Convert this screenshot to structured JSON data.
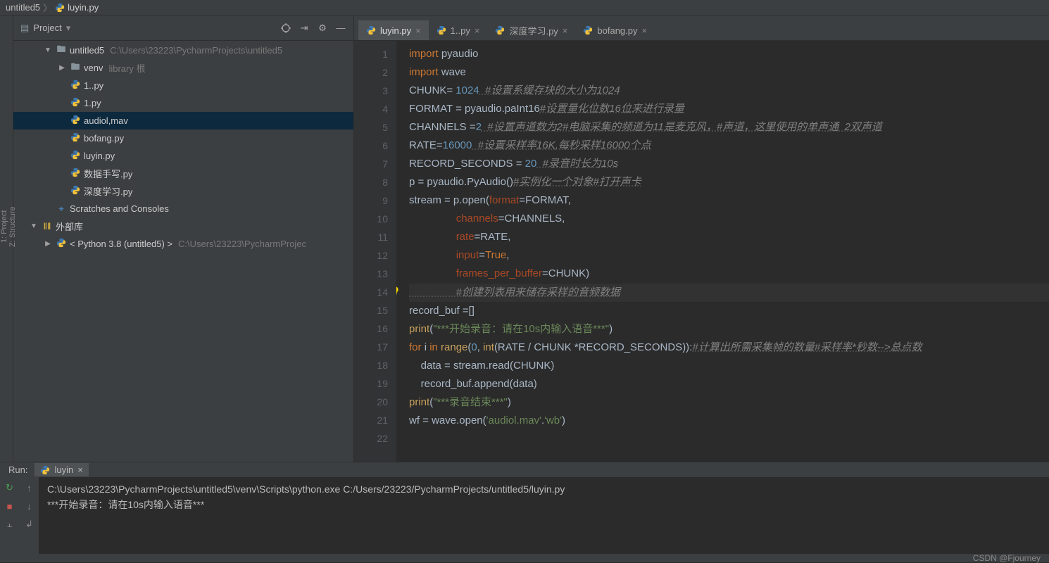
{
  "breadcrumb": {
    "project": "untitled5",
    "file": "luyin.py",
    "sep": "〉"
  },
  "sidebar": {
    "title": "Project",
    "tree": [
      {
        "depth": 0,
        "arrow": "▼",
        "icon": "folder",
        "label": "untitled5",
        "muted": "C:\\Users\\23223\\PycharmProjects\\untitled5",
        "sel": false
      },
      {
        "depth": 1,
        "arrow": "▶",
        "icon": "folder",
        "label": "venv",
        "muted": "library 根",
        "sel": false
      },
      {
        "depth": 1,
        "arrow": "",
        "icon": "py",
        "label": "1..py",
        "sel": false
      },
      {
        "depth": 1,
        "arrow": "",
        "icon": "py",
        "label": "1.py",
        "sel": false
      },
      {
        "depth": 1,
        "arrow": "",
        "icon": "py",
        "label": "audiol,mav",
        "sel": true
      },
      {
        "depth": 1,
        "arrow": "",
        "icon": "py",
        "label": "bofang.py",
        "sel": false
      },
      {
        "depth": 1,
        "arrow": "",
        "icon": "py",
        "label": "luyin.py",
        "sel": false
      },
      {
        "depth": 1,
        "arrow": "",
        "icon": "py",
        "label": "数据手写.py",
        "sel": false
      },
      {
        "depth": 1,
        "arrow": "",
        "icon": "py",
        "label": "深度学习.py",
        "sel": false
      },
      {
        "depth": 0,
        "arrow": "",
        "icon": "scratch",
        "label": "Scratches and Consoles",
        "sel": false
      },
      {
        "depth": -1,
        "arrow": "▼",
        "icon": "lib",
        "label": "外部库",
        "sel": false
      },
      {
        "depth": 0,
        "arrow": "▶",
        "icon": "python",
        "label": "< Python 3.8 (untitled5) >",
        "muted": "C:\\Users\\23223\\PycharmProjec",
        "sel": false
      }
    ]
  },
  "left_tools": [
    "1: Project",
    "Z: Structure"
  ],
  "tabs": [
    {
      "label": "luyin.py",
      "active": true
    },
    {
      "label": "1..py",
      "active": false
    },
    {
      "label": "深度学习.py",
      "active": false
    },
    {
      "label": "bofang.py",
      "active": false
    }
  ],
  "code": {
    "lines": [
      [
        {
          "t": "import ",
          "c": "kw"
        },
        {
          "t": "pyaudio"
        }
      ],
      [
        {
          "t": "import ",
          "c": "kw"
        },
        {
          "t": "wave"
        }
      ],
      [
        {
          "t": "CHUNK= "
        },
        {
          "t": "1024",
          "c": "num"
        },
        {
          "t": "  #设置系缓存块的大小为1024",
          "c": "cm"
        }
      ],
      [
        {
          "t": "FORMAT = pyaudio.paInt16"
        },
        {
          "t": "#设置量化位数16位来进行录量",
          "c": "cm"
        }
      ],
      [
        {
          "t": "CHANNELS ="
        },
        {
          "t": "2",
          "c": "num"
        },
        {
          "t": "  #设置声道数为2#电脑采集的频道为11是麦克风，#声道，这里使用的单声通  2双声道",
          "c": "cm"
        }
      ],
      [
        {
          "t": "RATE="
        },
        {
          "t": "16000",
          "c": "num"
        },
        {
          "t": "  #设置采样率16K,每秒采样16000个点",
          "c": "cm"
        }
      ],
      [
        {
          "t": "RECORD_SECONDS = "
        },
        {
          "t": "20",
          "c": "num"
        },
        {
          "t": "  #录音时长为10s",
          "c": "cm"
        }
      ],
      [
        {
          "t": "p = pyaudio.PyAudio()"
        },
        {
          "t": "#实例化一个对象#打开声卡",
          "c": "cm"
        }
      ],
      [
        {
          "t": "stream = p.open("
        },
        {
          "t": "format",
          "c": "par"
        },
        {
          "t": "=FORMAT,"
        }
      ],
      [
        {
          "t": "                "
        },
        {
          "t": "channels",
          "c": "par"
        },
        {
          "t": "=CHANNELS,"
        }
      ],
      [
        {
          "t": "                "
        },
        {
          "t": "rate",
          "c": "par"
        },
        {
          "t": "=RATE,"
        }
      ],
      [
        {
          "t": "                "
        },
        {
          "t": "input",
          "c": "par"
        },
        {
          "t": "="
        },
        {
          "t": "True",
          "c": "bool"
        },
        {
          "t": ","
        }
      ],
      [
        {
          "t": "                "
        },
        {
          "t": "frames_per_buffer",
          "c": "par"
        },
        {
          "t": "=CHUNK)"
        }
      ],
      [
        {
          "t": "                #创建列表用来储存采样的音频数据",
          "c": "cm",
          "hl": true,
          "bulb": true
        }
      ],
      [
        {
          "t": "record_buf =[]"
        }
      ],
      [
        {
          "t": "print",
          "c": "fn"
        },
        {
          "t": "("
        },
        {
          "t": "\"***开始录音：请在10s内输入语音***\"",
          "c": "str"
        },
        {
          "t": ")"
        }
      ],
      [
        {
          "t": "for ",
          "c": "kw"
        },
        {
          "t": "i "
        },
        {
          "t": "in ",
          "c": "kw"
        },
        {
          "t": "range",
          "c": "fn"
        },
        {
          "t": "("
        },
        {
          "t": "0",
          "c": "num"
        },
        {
          "t": ", "
        },
        {
          "t": "int",
          "c": "fn"
        },
        {
          "t": "(RATE / CHUNK *RECORD_SECONDS)):"
        },
        {
          "t": "#计算出所需采集帧的数量#采样率*秒数-->总点数",
          "c": "cm"
        }
      ],
      [
        {
          "t": "    data = stream.read(CHUNK)"
        }
      ],
      [
        {
          "t": "    record_buf.append(data)"
        }
      ],
      [
        {
          "t": "print",
          "c": "fn"
        },
        {
          "t": "("
        },
        {
          "t": "\"***录音结束***\"",
          "c": "str"
        },
        {
          "t": ")"
        }
      ],
      [
        {
          "t": ""
        }
      ],
      [
        {
          "t": "wf = wave.open("
        },
        {
          "t": "'audiol.mav'",
          "c": "str"
        },
        {
          "t": "."
        },
        {
          "t": "'wb'",
          "c": "str"
        },
        {
          "t": ")"
        }
      ]
    ]
  },
  "run": {
    "label": "Run:",
    "tab": "luyin"
  },
  "console": {
    "lines": [
      "C:\\Users\\23223\\PycharmProjects\\untitled5\\venv\\Scripts\\python.exe C:/Users/23223/PycharmProjects/untitled5/luyin.py",
      "***开始录音：请在10s内输入语音***"
    ]
  },
  "status": {
    "text": "CSDN @Fjourney"
  }
}
